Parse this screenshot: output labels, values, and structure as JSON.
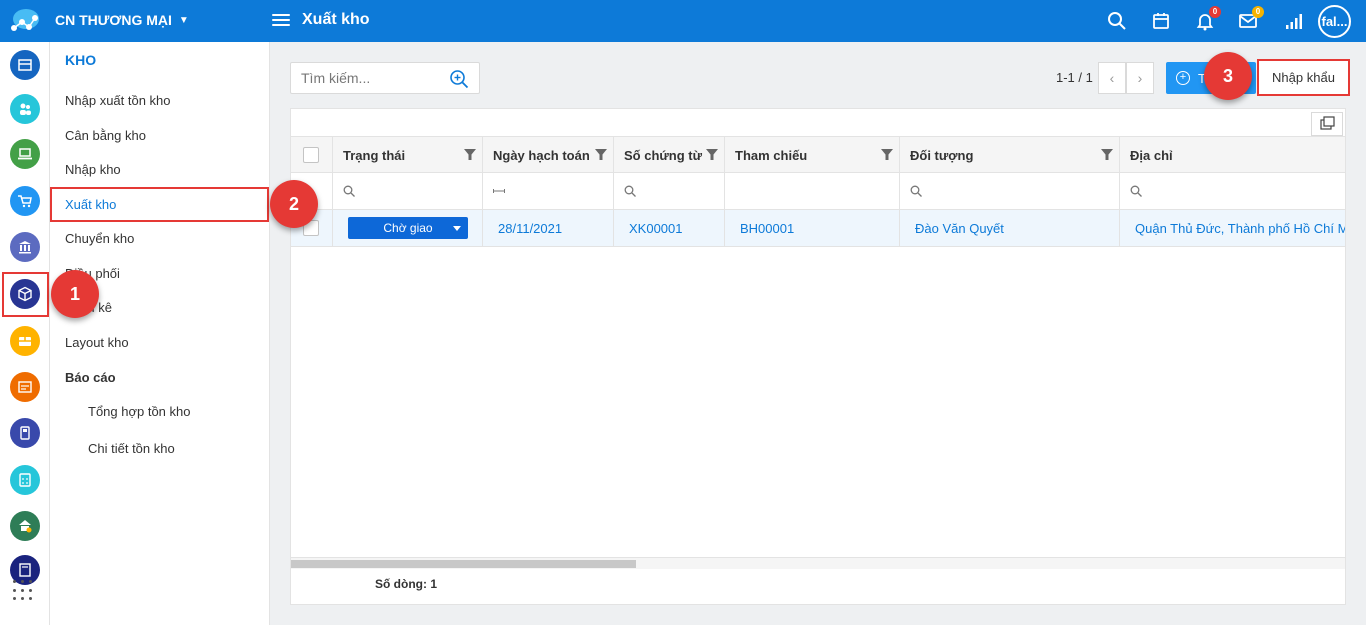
{
  "topbar": {
    "branch": "CN THƯƠNG MẠI",
    "title": "Xuất kho",
    "notification_count": "0",
    "mail_count": "0",
    "avatar": "fal..."
  },
  "rail": {
    "icons": [
      "store-icon",
      "customers-icon",
      "laptop-icon",
      "cart-icon",
      "bank-icon",
      "warehouse-box-icon",
      "package-icon",
      "invoice-icon",
      "payroll-icon",
      "calculator-icon",
      "asset-icon",
      "book-icon"
    ]
  },
  "menu": {
    "heading": "KHO",
    "items": [
      {
        "label": "Nhập xuất tồn kho"
      },
      {
        "label": "Cân bằng kho"
      },
      {
        "label": "Nhập kho"
      },
      {
        "label": "Xuất kho"
      },
      {
        "label": "Chuyển kho"
      },
      {
        "label": "Điều phối"
      },
      {
        "label": "Kiểm kê"
      },
      {
        "label": "Layout kho"
      },
      {
        "label": "Báo cáo"
      },
      {
        "label": "Tổng hợp tồn kho"
      },
      {
        "label": "Chi tiết tồn kho"
      }
    ]
  },
  "callouts": [
    "1",
    "2",
    "3"
  ],
  "toolbar": {
    "search_placeholder": "Tìm kiếm...",
    "pager": "1-1 / 1",
    "add_label": "T",
    "import_label": "Nhập khẩu"
  },
  "grid": {
    "columns": [
      "Trạng thái",
      "Ngày hạch toán",
      "Số chứng từ",
      "Tham chiếu",
      "Đối tượng",
      "Địa chỉ"
    ],
    "rows": [
      {
        "status": "Chờ giao",
        "date": "28/11/2021",
        "doc_no": "XK00001",
        "ref": "BH00001",
        "partner": "Đào Văn Quyết",
        "address": "Quận Thủ Đức, Thành phố Hồ Chí Minh"
      }
    ],
    "row_count_label": "Số dòng: 1"
  },
  "colors": {
    "brand": "#0d7ad8",
    "callout": "#e53935"
  }
}
